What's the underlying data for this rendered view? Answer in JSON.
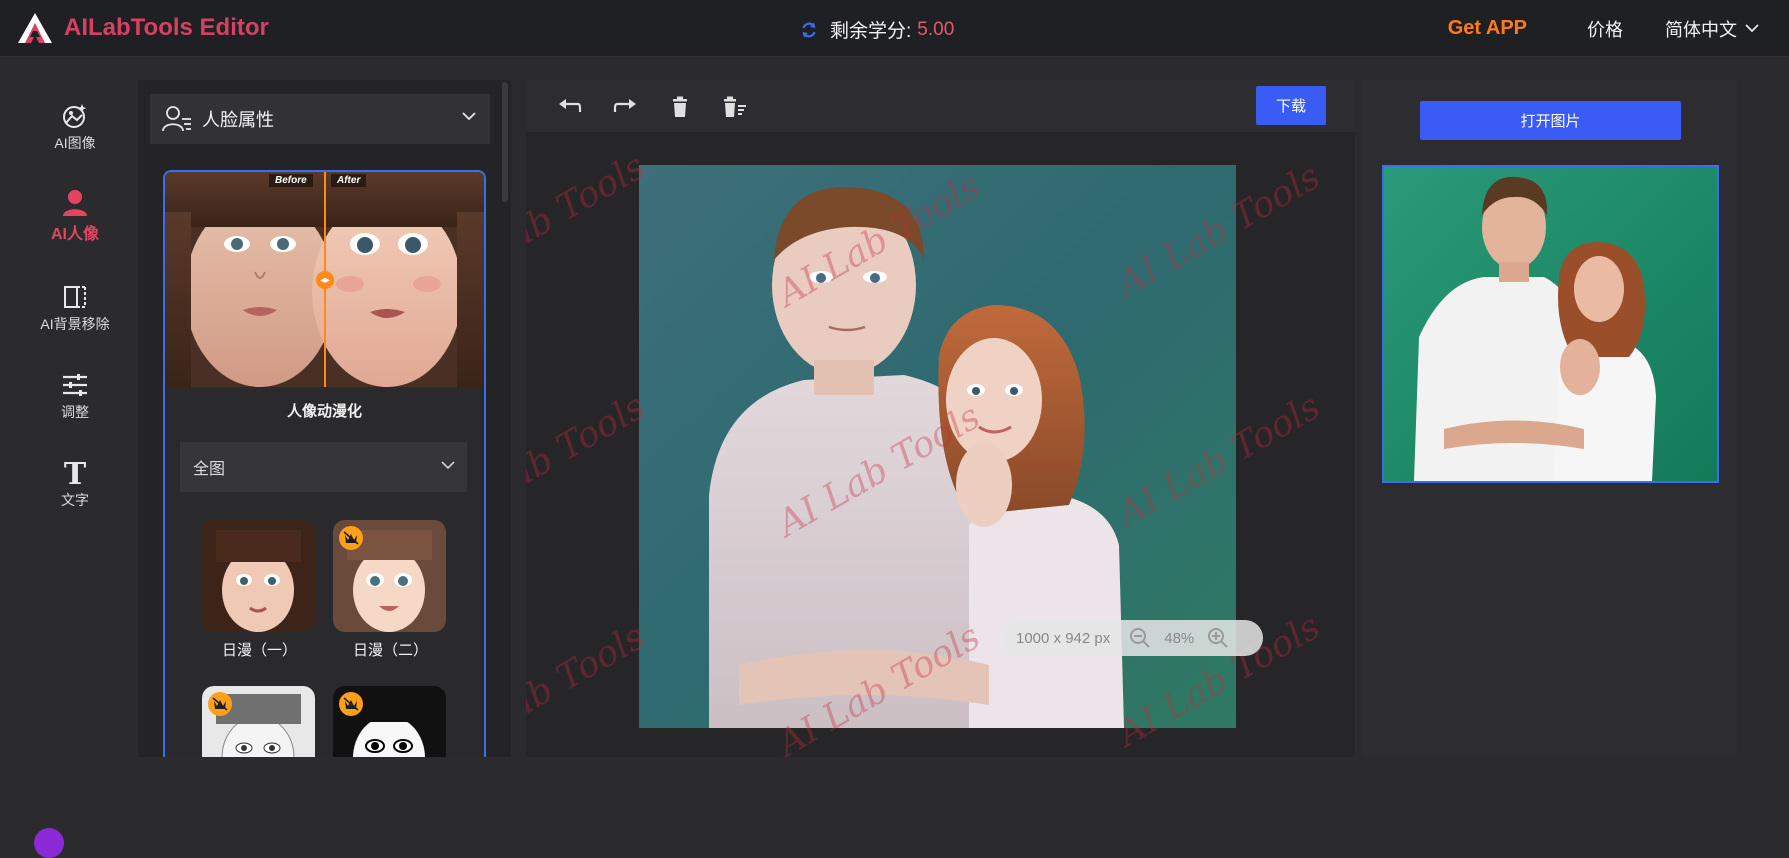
{
  "header": {
    "brand": "AILabTools Editor",
    "credits_label": "剩余学分:",
    "credits_value": "5.00",
    "get_app": "Get APP",
    "price": "价格",
    "language": "简体中文"
  },
  "sidebar": {
    "items": [
      {
        "label": "AI图像",
        "icon": "ai-image-icon"
      },
      {
        "label": "AI人像",
        "icon": "portrait-icon",
        "active": true
      },
      {
        "label": "AI背景移除",
        "icon": "bg-remove-icon"
      },
      {
        "label": "调整",
        "icon": "adjust-sliders-icon"
      },
      {
        "label": "文字",
        "icon": "text-icon"
      }
    ]
  },
  "tool_panel": {
    "title": "人脸属性",
    "before_label": "Before",
    "after_label": "After",
    "feature_name": "人像动漫化",
    "scope": "全图",
    "styles": [
      {
        "label": "日漫（一）",
        "premium": false
      },
      {
        "label": "日漫（二）",
        "premium": true
      },
      {
        "label": "",
        "premium": true
      },
      {
        "label": "",
        "premium": true
      }
    ]
  },
  "workspace": {
    "download_label": "下载",
    "image_dims": "1000 x 942 px",
    "zoom": "48%",
    "watermark_text": "AI Lab Tools"
  },
  "right_panel": {
    "open_label": "打开图片"
  },
  "colors": {
    "accent_blue": "#3a5cf5",
    "brand_pink": "#d64063",
    "get_app_orange": "#ff7a1a"
  }
}
